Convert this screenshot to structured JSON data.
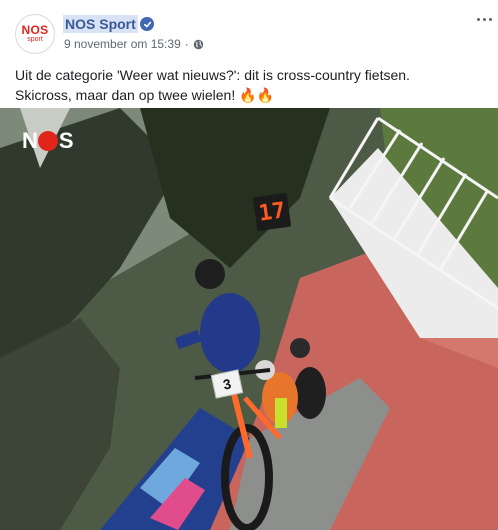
{
  "post": {
    "page_name": "NOS Sport",
    "avatar": {
      "logo_text": "NOS",
      "logo_sub": "sport"
    },
    "timestamp": "9 november om 15:39",
    "separator": "·",
    "privacy_icon": "globe-icon",
    "verified_icon": "verified-badge-icon",
    "more_icon": "more-options-icon",
    "text": "Uit de categorie 'Weer wat nieuws?': dit is cross-country fietsen.\nSkicross, maar dan op twee wielen! 🔥🔥"
  },
  "video": {
    "watermark": {
      "before": "N",
      "after": "S"
    },
    "race_timer": "17",
    "bib_number": "3"
  },
  "colors": {
    "link": "#385898",
    "link_highlight": "#d7e3f4",
    "verified": "#4267b2",
    "nos_red": "#e2251b",
    "meta_gray": "#606770"
  }
}
